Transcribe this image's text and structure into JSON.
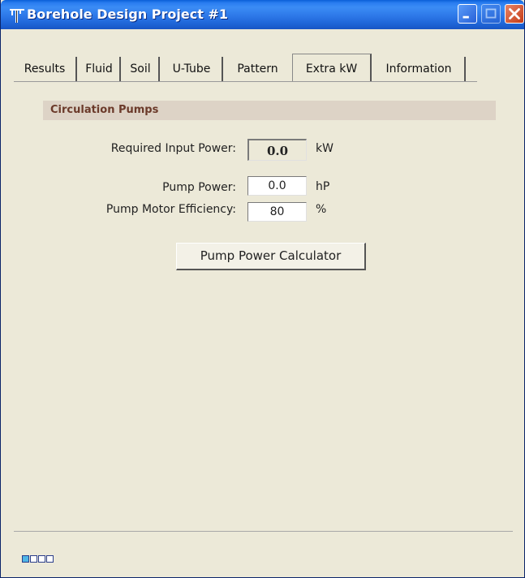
{
  "window": {
    "title": "Borehole Design Project #1",
    "app_icon": "borehole-rig-icon",
    "controls": [
      "minimize-icon",
      "maximize-icon",
      "close-icon"
    ]
  },
  "tabs": [
    {
      "label": "Results",
      "active": false
    },
    {
      "label": "Fluid",
      "active": false
    },
    {
      "label": "Soil",
      "active": false
    },
    {
      "label": "U-Tube",
      "active": false
    },
    {
      "label": "Pattern",
      "active": false
    },
    {
      "label": "Extra kW",
      "active": true
    },
    {
      "label": "Information",
      "active": false
    }
  ],
  "section": {
    "title": "Circulation Pumps"
  },
  "fields": {
    "required_input_power": {
      "label": "Required Input Power:",
      "value": "0.0",
      "unit": "kW"
    },
    "pump_power": {
      "label": "Pump Power:",
      "value": "0.0",
      "unit": "hP"
    },
    "pump_motor_efficiency": {
      "label": "Pump Motor Efficiency:",
      "value": "80",
      "unit": "%"
    }
  },
  "buttons": {
    "pump_power_calculator": "Pump Power Calculator"
  },
  "status": {
    "progress_segments_total": 4,
    "progress_segments_filled": 1
  },
  "colors": {
    "titlebar": "#2a7df0",
    "section_header_bg": "#ddd3c6",
    "section_header_text": "#6b3a2a",
    "progress_fill": "#4fb6e6"
  }
}
